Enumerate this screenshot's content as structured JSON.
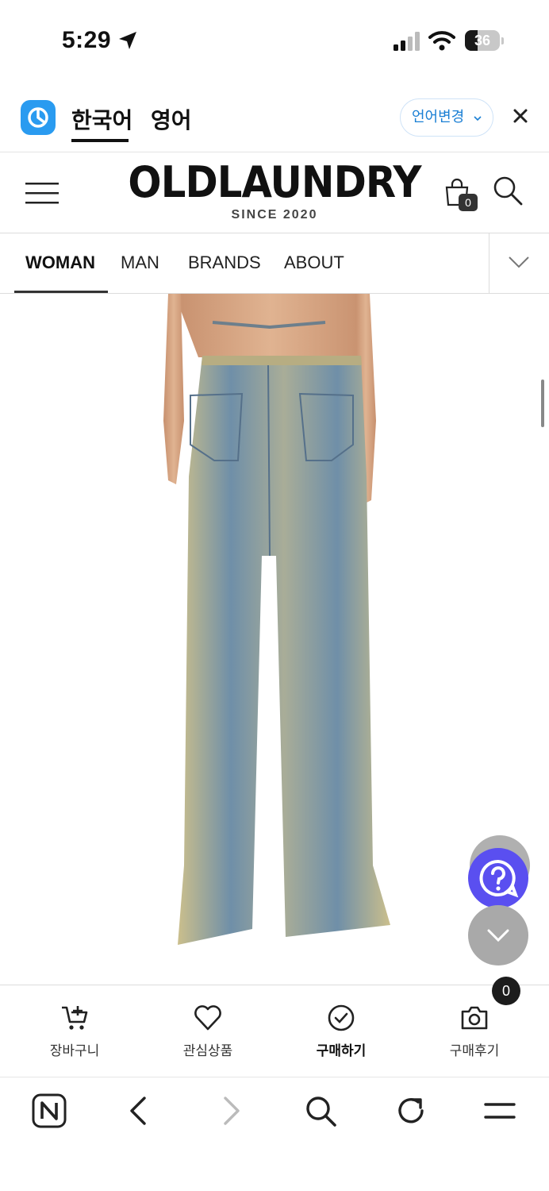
{
  "status_bar": {
    "time": "5:29",
    "battery_level": "36",
    "battery_fraction": 0.36,
    "icons": [
      "location-arrow-icon",
      "signal-icon",
      "wifi-icon",
      "battery-icon"
    ]
  },
  "translate_bar": {
    "tabs": [
      {
        "label": "한국어",
        "active": true
      },
      {
        "label": "영어",
        "active": false
      }
    ],
    "change_language_label": "언어변경",
    "accent_color": "#1a7fd4"
  },
  "header": {
    "logo_title": "OLDLAUNDRY",
    "logo_subtitle": "SINCE 2020",
    "cart_count": "0"
  },
  "category_nav": {
    "items": [
      {
        "label": "WOMAN",
        "active": true
      },
      {
        "label": "MAN"
      },
      {
        "label": "BRANDS"
      },
      {
        "label": "ABOUT"
      }
    ]
  },
  "floating": {
    "help_color": "#5a4ff0"
  },
  "action_bar": {
    "items": [
      {
        "label": "장바구니",
        "icon": "cart-add-icon"
      },
      {
        "label": "관심상품",
        "icon": "heart-icon"
      },
      {
        "label": "구매하기",
        "icon": "check-circle-icon"
      },
      {
        "label": "구매후기",
        "icon": "camera-icon"
      }
    ],
    "review_count": "0"
  },
  "browser_bar": {
    "icons": [
      "naver-n-icon",
      "back-icon",
      "forward-icon",
      "search-icon",
      "reload-icon",
      "menu-icon"
    ]
  }
}
